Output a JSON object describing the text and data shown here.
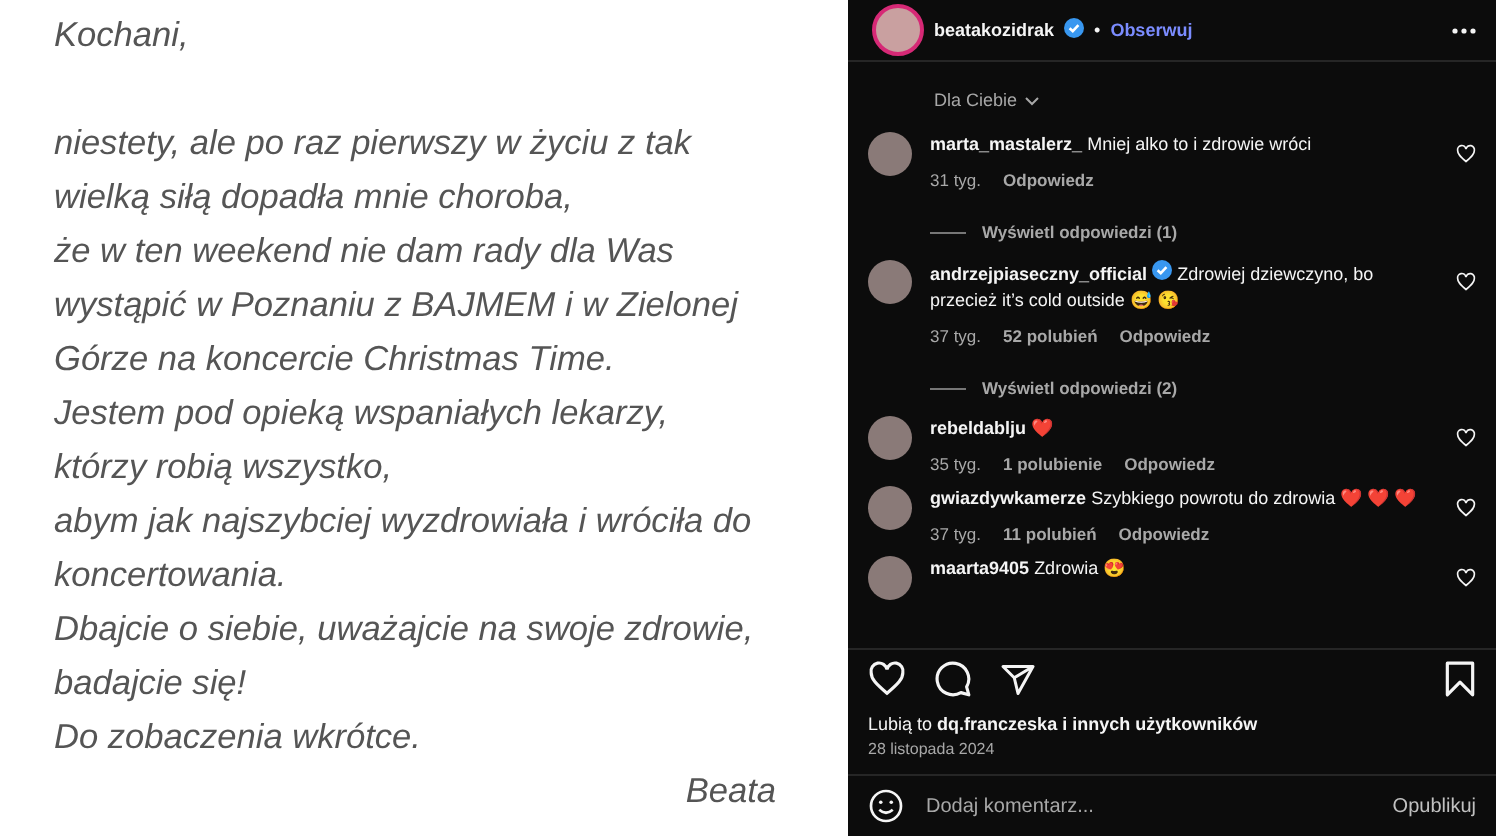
{
  "post_text": {
    "greeting": "Kochani,",
    "lines": [
      "niestety, ale po raz pierwszy w życiu z tak",
      "wielką siłą dopadła mnie choroba,",
      "że w ten weekend nie dam rady dla Was",
      "wystąpić w Poznaniu z BAJMEM i w Zielonej",
      "Górze na koncercie Christmas Time.",
      "Jestem pod opieką wspaniałych lekarzy,",
      "którzy robią wszystko,",
      "abym jak najszybciej wyzdrowiała i wróciła do",
      "koncertowania.",
      "Dbajcie o siebie, uważajcie na swoje zdrowie,",
      "badajcie się!",
      "Do zobaczenia wkrótce."
    ],
    "signature": "Beata"
  },
  "header": {
    "username": "beatakozidrak",
    "verified": true,
    "separator": "•",
    "follow": "Obserwuj"
  },
  "sort": "Dla Ciebie",
  "comments": [
    {
      "username": "marta_mastalerz_",
      "verified": false,
      "text": "Mniej alko to i zdrowie wróci",
      "time": "31 tyg.",
      "reply": "Odpowiedz",
      "view_replies": "Wyświetl odpowiedzi (1)"
    },
    {
      "username": "andrzejpiaseczny_official",
      "verified": true,
      "text": "Zdrowiej dziewczyno, bo przecież it’s cold outside 😅 😘",
      "time": "37 tyg.",
      "likes": "52 polubień",
      "reply": "Odpowiedz",
      "view_replies": "Wyświetl odpowiedzi (2)"
    },
    {
      "username": "rebeldablju",
      "verified": false,
      "text": "❤️",
      "time": "35 tyg.",
      "likes": "1 polubienie",
      "reply": "Odpowiedz"
    },
    {
      "username": "gwiazdywkamerze",
      "verified": false,
      "text": "Szybkiego powrotu do zdrowia ❤️ ❤️ ❤️",
      "time": "37 tyg.",
      "likes": "11 polubień",
      "reply": "Odpowiedz"
    },
    {
      "username": "maarta9405",
      "verified": false,
      "text": "Zdrowia 😍"
    }
  ],
  "likes_line": {
    "prefix": "Lubią to",
    "user": "dq.franczeska",
    "suffix": "i innych użytkowników"
  },
  "date": "28 listopada 2024",
  "comment_box": {
    "placeholder": "Dodaj komentarz...",
    "submit": "Opublikuj"
  }
}
